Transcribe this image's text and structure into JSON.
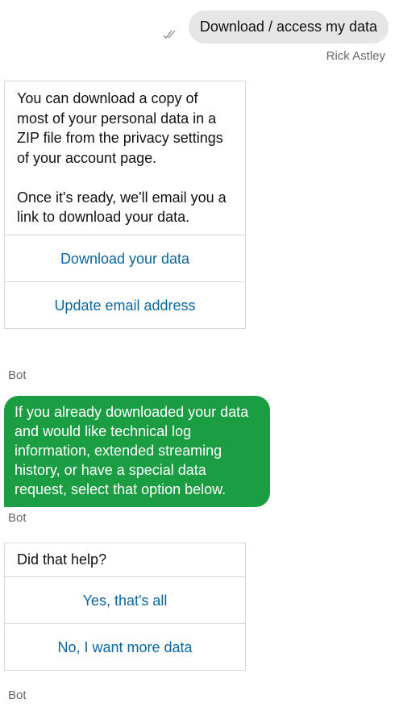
{
  "user_message": {
    "text": "Download / access my data",
    "sender": "Rick Astley",
    "read_icon": "double-check-icon"
  },
  "bot_card_1": {
    "text": "You can download a copy of most of your personal data in a ZIP file from the privacy settings of your account page.\n\nOnce it's ready, we'll email you a link to download your data.",
    "buttons": [
      "Download your data",
      "Update email address"
    ],
    "sender": "Bot"
  },
  "bot_bubble": {
    "text": "If you already downloaded your data and would like technical log information, extended streaming history, or have a special data request, select that option below.",
    "sender": "Bot",
    "color": "#1a9d43"
  },
  "bot_card_2": {
    "text": "Did that help?",
    "buttons": [
      "Yes, that's all",
      "No, I want more data"
    ],
    "sender": "Bot"
  },
  "colors": {
    "button_text": "#0a66a3",
    "user_bubble": "#e6e6e6",
    "muted_text": "#666666"
  }
}
